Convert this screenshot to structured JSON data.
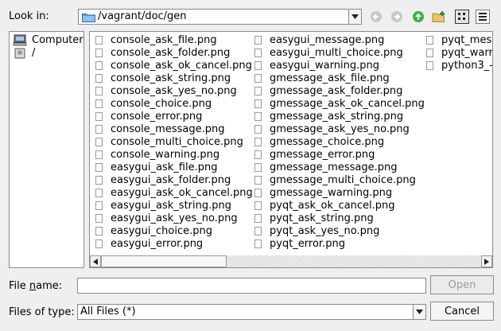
{
  "look_in": {
    "label": "Look in:",
    "path": "/vagrant/doc/gen"
  },
  "toolbar": {
    "icons": [
      "back-icon",
      "forward-icon",
      "parent-folder-icon",
      "new-folder-icon",
      "list-view-icon",
      "detail-view-icon"
    ]
  },
  "sidebar": {
    "items": [
      {
        "label": "Computer",
        "icon": "computer-icon"
      },
      {
        "label": "/",
        "icon": "drive-icon"
      }
    ]
  },
  "files": {
    "columns": [
      [
        "console_ask_file.png",
        "console_ask_folder.png",
        "console_ask_ok_cancel.png",
        "console_ask_string.png",
        "console_ask_yes_no.png",
        "console_choice.png",
        "console_error.png",
        "console_message.png",
        "console_multi_choice.png",
        "console_warning.png",
        "easygui_ask_file.png",
        "easygui_ask_folder.png",
        "easygui_ask_ok_cancel.png",
        "easygui_ask_string.png",
        "easygui_ask_yes_no.png",
        "easygui_choice.png",
        "easygui_error.png"
      ],
      [
        "easygui_message.png",
        "easygui_multi_choice.png",
        "easygui_warning.png",
        "gmessage_ask_file.png",
        "gmessage_ask_folder.png",
        "gmessage_ask_ok_cancel.png",
        "gmessage_ask_string.png",
        "gmessage_ask_yes_no.png",
        "gmessage_choice.png",
        "gmessage_error.png",
        "gmessage_message.png",
        "gmessage_multi_choice.png",
        "gmessage_warning.png",
        "pyqt_ask_ok_cancel.png",
        "pyqt_ask_string.png",
        "pyqt_ask_yes_no.png",
        "pyqt_error.png"
      ],
      [
        "pyqt_mess",
        "pyqt_warr",
        "python3_-"
      ]
    ]
  },
  "filename": {
    "label_pre": "File ",
    "label_u": "n",
    "label_post": "ame:",
    "value": ""
  },
  "filetype": {
    "label": "Files of type:",
    "value": "All Files (*)"
  },
  "buttons": {
    "open": "Open",
    "cancel": "Cancel"
  }
}
